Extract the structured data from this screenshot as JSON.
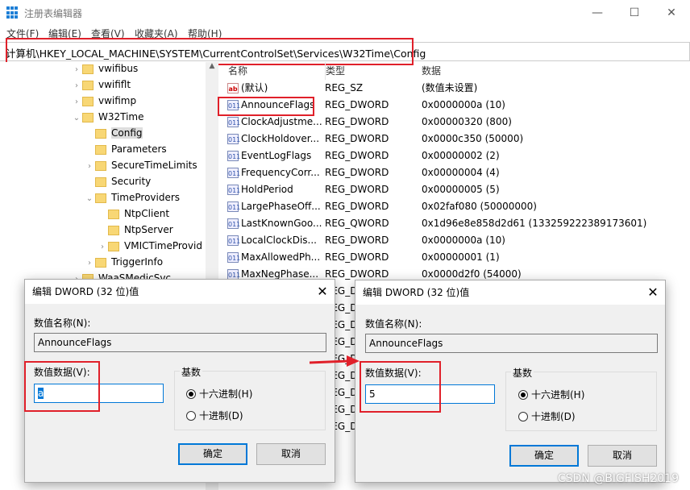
{
  "window": {
    "title": "注册表编辑器",
    "minimize": "—",
    "maximize": "☐",
    "close": "✕"
  },
  "menu": [
    "文件(F)",
    "编辑(E)",
    "查看(V)",
    "收藏夹(A)",
    "帮助(H)"
  ],
  "address": "计算机\\HKEY_LOCAL_MACHINE\\SYSTEM\\CurrentControlSet\\Services\\W32Time\\Config",
  "tree": [
    {
      "label": "vwifibus",
      "level": 0,
      "expander": "›"
    },
    {
      "label": "vwififlt",
      "level": 0,
      "expander": "›"
    },
    {
      "label": "vwifimp",
      "level": 0,
      "expander": "›"
    },
    {
      "label": "W32Time",
      "level": 0,
      "expander": "⌄"
    },
    {
      "label": "Config",
      "level": 1,
      "expander": "",
      "selected": true
    },
    {
      "label": "Parameters",
      "level": 1,
      "expander": ""
    },
    {
      "label": "SecureTimeLimits",
      "level": 1,
      "expander": "›"
    },
    {
      "label": "Security",
      "level": 1,
      "expander": ""
    },
    {
      "label": "TimeProviders",
      "level": 1,
      "expander": "⌄"
    },
    {
      "label": "NtpClient",
      "level": 2,
      "expander": ""
    },
    {
      "label": "NtpServer",
      "level": 2,
      "expander": ""
    },
    {
      "label": "VMICTimeProvid",
      "level": 2,
      "expander": "›"
    },
    {
      "label": "TriggerInfo",
      "level": 1,
      "expander": "›"
    },
    {
      "label": "WaaSMedicSvc",
      "level": 0,
      "expander": "›"
    }
  ],
  "columns": {
    "name": "名称",
    "type": "类型",
    "data": "数据"
  },
  "values": [
    {
      "name": "(默认)",
      "type": "REG_SZ",
      "data": "(数值未设置)",
      "icon": "ab"
    },
    {
      "name": "AnnounceFlags",
      "type": "REG_DWORD",
      "data": "0x0000000a (10)",
      "icon": "011"
    },
    {
      "name": "ClockAdjustme...",
      "type": "REG_DWORD",
      "data": "0x00000320 (800)",
      "icon": "011"
    },
    {
      "name": "ClockHoldover...",
      "type": "REG_DWORD",
      "data": "0x0000c350 (50000)",
      "icon": "011"
    },
    {
      "name": "EventLogFlags",
      "type": "REG_DWORD",
      "data": "0x00000002 (2)",
      "icon": "011"
    },
    {
      "name": "FrequencyCorr...",
      "type": "REG_DWORD",
      "data": "0x00000004 (4)",
      "icon": "011"
    },
    {
      "name": "HoldPeriod",
      "type": "REG_DWORD",
      "data": "0x00000005 (5)",
      "icon": "011"
    },
    {
      "name": "LargePhaseOff...",
      "type": "REG_DWORD",
      "data": "0x02faf080 (50000000)",
      "icon": "011"
    },
    {
      "name": "LastKnownGoo...",
      "type": "REG_QWORD",
      "data": "0x1d96e8e858d2d61 (133259222389173601)",
      "icon": "011"
    },
    {
      "name": "LocalClockDis...",
      "type": "REG_DWORD",
      "data": "0x0000000a (10)",
      "icon": "011"
    },
    {
      "name": "MaxAllowedPh...",
      "type": "REG_DWORD",
      "data": "0x00000001 (1)",
      "icon": "011"
    },
    {
      "name": "MaxNegPhase...",
      "type": "REG_DWORD",
      "data": "0x0000d2f0 (54000)",
      "icon": "011"
    },
    {
      "name": "",
      "type": "REG_DWORD",
      "data": "",
      "icon": ""
    },
    {
      "name": "",
      "type": "REG_DWORD",
      "data": "",
      "icon": ""
    },
    {
      "name": "",
      "type": "REG_DWORD",
      "data": "",
      "icon": ""
    },
    {
      "name": "",
      "type": "REG_DWORD",
      "data": "",
      "icon": ""
    },
    {
      "name": "",
      "type": "REG_DWORD",
      "data": "",
      "icon": ""
    },
    {
      "name": "",
      "type": "REG_DWORD",
      "data": "",
      "icon": ""
    },
    {
      "name": "",
      "type": "REG_DWORD",
      "data": "",
      "icon": ""
    },
    {
      "name": "",
      "type": "REG_DWORD",
      "data": "",
      "icon": ""
    },
    {
      "name": "",
      "type": "REG_DWORD",
      "data": "",
      "icon": ""
    }
  ],
  "dialog_before": {
    "title": "编辑 DWORD (32 位)值",
    "name_label": "数值名称(N):",
    "name_value": "AnnounceFlags",
    "data_label": "数值数据(V):",
    "data_value": "a",
    "base_label": "基数",
    "hex": "十六进制(H)",
    "dec": "十进制(D)",
    "base_selected": "hex",
    "ok": "确定",
    "cancel": "取消"
  },
  "dialog_after": {
    "title": "编辑 DWORD (32 位)值",
    "name_label": "数值名称(N):",
    "name_value": "AnnounceFlags",
    "data_label": "数值数据(V):",
    "data_value": "5",
    "base_label": "基数",
    "hex": "十六进制(H)",
    "dec": "十进制(D)",
    "base_selected": "hex",
    "ok": "确定",
    "cancel": "取消"
  },
  "watermark": "CSDN @BIGFISH2019",
  "colors": {
    "highlight": "#e0202a",
    "accent": "#0078d7"
  }
}
